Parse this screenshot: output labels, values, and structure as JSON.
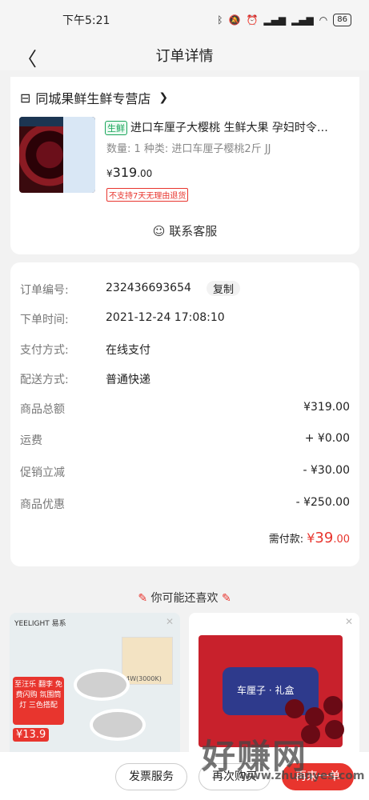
{
  "status": {
    "time": "下午5:21",
    "battery": "86"
  },
  "header": {
    "title": "订单详情"
  },
  "shop": {
    "name": "同城果鲜生鲜专营店",
    "product": {
      "tag": "生鲜",
      "name": "进口车厘子大樱桃 生鲜大果 孕妇时令…",
      "spec": "数量: 1  种类: 进口车厘子樱桃2斤 JJ",
      "price_symbol": "¥",
      "price_int": "319",
      "price_dec": ".00",
      "no_return": "不支持7天无理由退货"
    },
    "contact_label": "联系客服"
  },
  "details": {
    "order_no_label": "订单编号:",
    "order_no": "232436693654",
    "copy_label": "复制",
    "time_label": "下单时间:",
    "time": "2021-12-24 17:08:10",
    "pay_label": "支付方式:",
    "pay": "在线支付",
    "ship_label": "配送方式:",
    "ship": "普通快递",
    "rows": [
      {
        "label": "商品总额",
        "amount": "¥319.00"
      },
      {
        "label": "运费",
        "amount": "+ ¥0.00"
      },
      {
        "label": "促销立减",
        "amount": "- ¥30.00"
      },
      {
        "label": "商品优惠",
        "amount": "- ¥250.00"
      }
    ],
    "total_label": "需付款: ",
    "total_symbol": "¥",
    "total_int": "39",
    "total_dec": ".00"
  },
  "recommend": {
    "title": "你可能还喜欢",
    "item1": {
      "brand": "YEELIGHT 易系",
      "spec": "4W(3000K)",
      "promo": "至汪乐 翻李 免费闪购 氛围筒灯 三色搭配",
      "price": "¥13.9"
    },
    "item2": {
      "box_text": "车厘子 · 礼盒"
    }
  },
  "bottom": {
    "invoice": "发票服务",
    "more": "再次购买",
    "primary": "再来一单"
  },
  "watermark": {
    "text": "好赚网",
    "url": "www.zhuanyes.com"
  },
  "colors": {
    "accent": "#e8352e",
    "fresh": "#1aa55b"
  }
}
